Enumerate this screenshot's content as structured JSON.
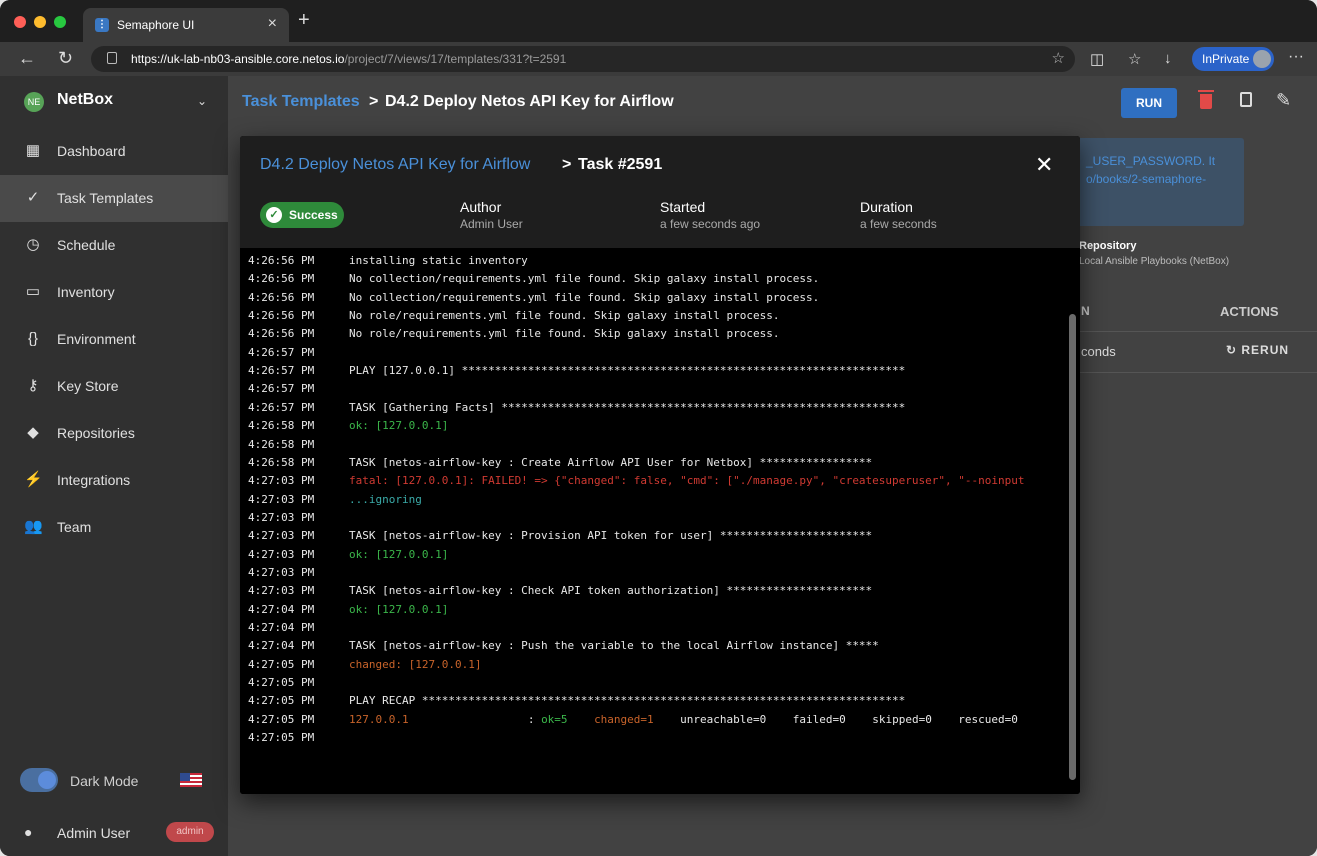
{
  "browser": {
    "tab_title": "Semaphore UI",
    "url_host": "https://uk-lab-nb03-ansible.core.netos.io",
    "url_path": "/project/7/views/17/templates/331?t=2591",
    "inprivate_label": "InPrivate"
  },
  "sidebar": {
    "project_initials": "NE",
    "project_name": "NetBox",
    "items": [
      {
        "label": "Dashboard",
        "icon": "dashboard-icon"
      },
      {
        "label": "Task Templates",
        "icon": "double-check-icon"
      },
      {
        "label": "Schedule",
        "icon": "clock-icon"
      },
      {
        "label": "Inventory",
        "icon": "monitor-icon"
      },
      {
        "label": "Environment",
        "icon": "braces-icon"
      },
      {
        "label": "Key Store",
        "icon": "key-icon"
      },
      {
        "label": "Repositories",
        "icon": "git-icon"
      },
      {
        "label": "Integrations",
        "icon": "plug-icon"
      },
      {
        "label": "Team",
        "icon": "team-icon"
      }
    ],
    "dark_mode_label": "Dark Mode",
    "user_name": "Admin User",
    "user_role": "admin"
  },
  "header": {
    "breadcrumb_link": "Task Templates",
    "breadcrumb_sep": ">",
    "breadcrumb_current": "D4.2 Deploy Netos API Key for Airflow",
    "run_label": "RUN"
  },
  "background": {
    "desc_line1": "_USER_PASSWORD. It",
    "desc_line2": "o/books/2-semaphore-",
    "repo_label": "Repository",
    "repo_value": "Local Ansible Playbooks (NetBox)",
    "col_partial": "N",
    "col_actions": "ACTIONS",
    "cell_duration": "conds",
    "rerun_label": "RERUN"
  },
  "dialog": {
    "template_link": "D4.2 Deploy Netos API Key for Airflow",
    "sep": ">",
    "task_label": "Task #2591",
    "status": "Success",
    "author_label": "Author",
    "author_value": "Admin User",
    "started_label": "Started",
    "started_value": "a few seconds ago",
    "duration_label": "Duration",
    "duration_value": "a few seconds"
  },
  "log": [
    {
      "time": "4:26:56 PM",
      "segments": [
        {
          "text": "installing static inventory",
          "cls": "c-white"
        }
      ]
    },
    {
      "time": "4:26:56 PM",
      "segments": [
        {
          "text": "No collection/requirements.yml file found. Skip galaxy install process.",
          "cls": "c-white"
        }
      ]
    },
    {
      "time": "4:26:56 PM",
      "segments": [
        {
          "text": "No collection/requirements.yml file found. Skip galaxy install process.",
          "cls": "c-white"
        }
      ]
    },
    {
      "time": "4:26:56 PM",
      "segments": [
        {
          "text": "No role/requirements.yml file found. Skip galaxy install process.",
          "cls": "c-white"
        }
      ]
    },
    {
      "time": "4:26:56 PM",
      "segments": [
        {
          "text": "No role/requirements.yml file found. Skip galaxy install process.",
          "cls": "c-white"
        }
      ]
    },
    {
      "time": "4:26:57 PM",
      "segments": []
    },
    {
      "time": "4:26:57 PM",
      "segments": [
        {
          "text": "PLAY [127.0.0.1] *******************************************************************",
          "cls": "c-white"
        }
      ]
    },
    {
      "time": "4:26:57 PM",
      "segments": []
    },
    {
      "time": "4:26:57 PM",
      "segments": [
        {
          "text": "TASK [Gathering Facts] *************************************************************",
          "cls": "c-white"
        }
      ]
    },
    {
      "time": "4:26:58 PM",
      "segments": [
        {
          "text": "ok: [127.0.0.1]",
          "cls": "c-ok"
        }
      ]
    },
    {
      "time": "4:26:58 PM",
      "segments": []
    },
    {
      "time": "4:26:58 PM",
      "segments": [
        {
          "text": "TASK [netos-airflow-key : Create Airflow API User for Netbox] *****************",
          "cls": "c-white"
        }
      ]
    },
    {
      "time": "4:27:03 PM",
      "segments": [
        {
          "text": "fatal: [127.0.0.1]: FAILED! => {\"changed\": false, \"cmd\": [\"./manage.py\", \"createsuperuser\", \"--noinput",
          "cls": "c-fail"
        }
      ]
    },
    {
      "time": "4:27:03 PM",
      "segments": [
        {
          "text": "...ignoring",
          "cls": "c-warn"
        }
      ]
    },
    {
      "time": "4:27:03 PM",
      "segments": []
    },
    {
      "time": "4:27:03 PM",
      "segments": [
        {
          "text": "TASK [netos-airflow-key : Provision API token for user] ***********************",
          "cls": "c-white"
        }
      ]
    },
    {
      "time": "4:27:03 PM",
      "segments": [
        {
          "text": "ok: [127.0.0.1]",
          "cls": "c-ok"
        }
      ]
    },
    {
      "time": "4:27:03 PM",
      "segments": []
    },
    {
      "time": "4:27:03 PM",
      "segments": [
        {
          "text": "TASK [netos-airflow-key : Check API token authorization] **********************",
          "cls": "c-white"
        }
      ]
    },
    {
      "time": "4:27:04 PM",
      "segments": [
        {
          "text": "ok: [127.0.0.1]",
          "cls": "c-ok"
        }
      ]
    },
    {
      "time": "4:27:04 PM",
      "segments": []
    },
    {
      "time": "4:27:04 PM",
      "segments": [
        {
          "text": "TASK [netos-airflow-key : Push the variable to the local Airflow instance] *****",
          "cls": "c-white"
        }
      ]
    },
    {
      "time": "4:27:05 PM",
      "segments": [
        {
          "text": "changed: [127.0.0.1]",
          "cls": "c-chg"
        }
      ]
    },
    {
      "time": "4:27:05 PM",
      "segments": []
    },
    {
      "time": "4:27:05 PM",
      "segments": [
        {
          "text": "PLAY RECAP *************************************************************************",
          "cls": "c-white"
        }
      ]
    },
    {
      "time": "4:27:05 PM",
      "segments": [
        {
          "text": "127.0.0.1",
          "cls": "c-chg"
        },
        {
          "text": "                  : ",
          "cls": "c-white"
        },
        {
          "text": "ok=5",
          "cls": "c-ok"
        },
        {
          "text": "    ",
          "cls": "c-white"
        },
        {
          "text": "changed=1",
          "cls": "c-chg"
        },
        {
          "text": "    unreachable=0    failed=0    skipped=0    rescued=0",
          "cls": "c-white"
        }
      ]
    },
    {
      "time": "4:27:05 PM",
      "segments": []
    }
  ]
}
